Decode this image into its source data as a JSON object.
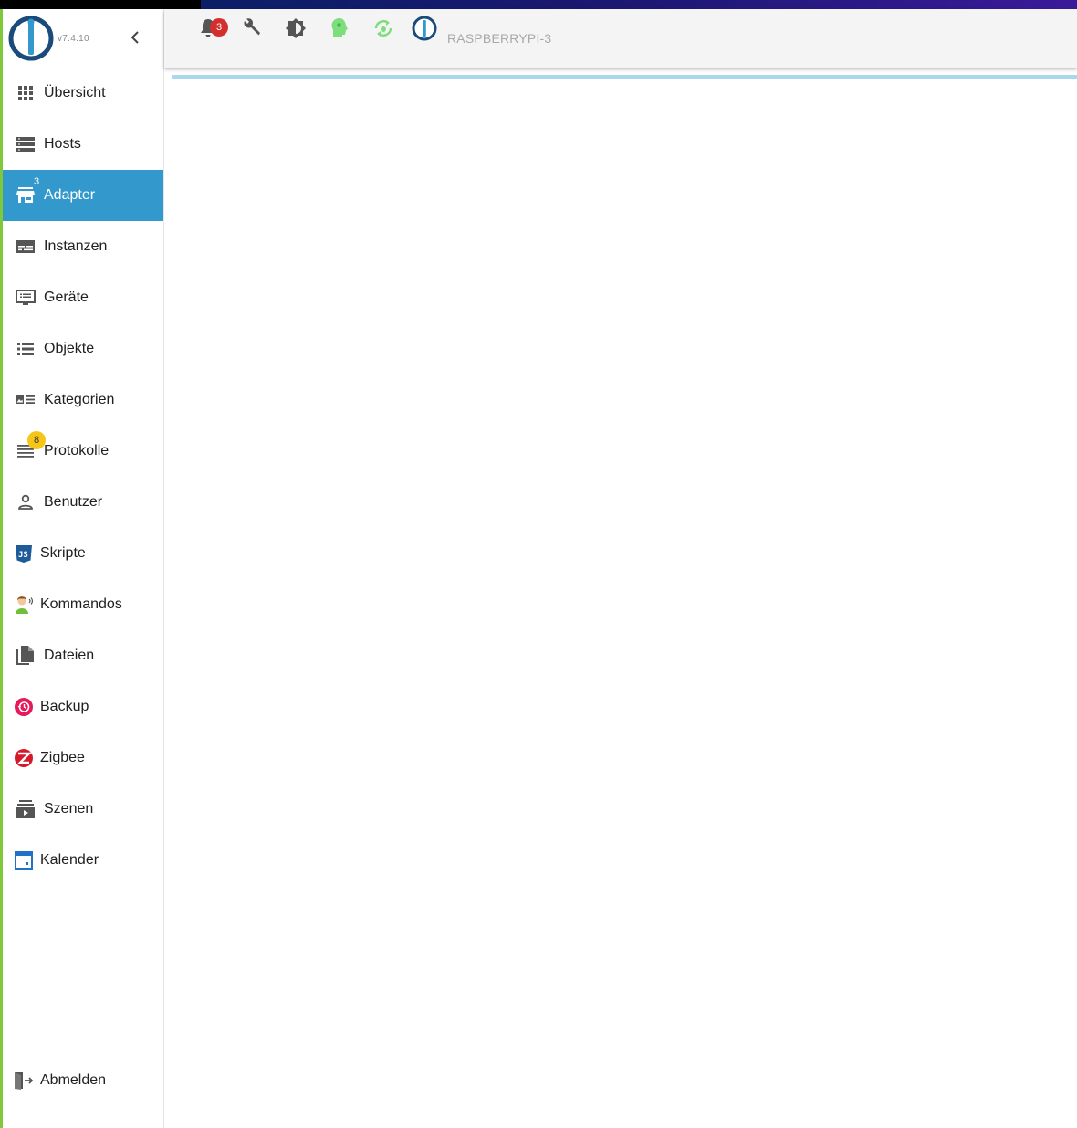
{
  "app": {
    "version": "v7.4.10",
    "hostname": "RASPBERRYPI-3",
    "notifications_count": "3",
    "accent_color": "#3399cc",
    "sidebar_border_color": "#7ec83a"
  },
  "toolbar": {
    "icons": [
      "bell-icon",
      "wrench-icon",
      "brightness-icon",
      "expert-mode-icon",
      "refresh-icon",
      "iobroker-logo-icon"
    ]
  },
  "sidebar": {
    "items": [
      {
        "label": "Übersicht",
        "icon": "grid-icon"
      },
      {
        "label": "Hosts",
        "icon": "server-icon"
      },
      {
        "label": "Adapter",
        "icon": "store-icon",
        "badge": "3",
        "active": true
      },
      {
        "label": "Instanzen",
        "icon": "instances-icon"
      },
      {
        "label": "Geräte",
        "icon": "devices-icon"
      },
      {
        "label": "Objekte",
        "icon": "list-icon"
      },
      {
        "label": "Kategorien",
        "icon": "categories-icon"
      },
      {
        "label": "Protokolle",
        "icon": "log-icon",
        "badge": "8"
      },
      {
        "label": "Benutzer",
        "icon": "user-icon"
      },
      {
        "label": "Skripte",
        "icon": "javascript-icon"
      },
      {
        "label": "Kommandos",
        "icon": "voice-command-icon"
      },
      {
        "label": "Dateien",
        "icon": "files-icon"
      },
      {
        "label": "Backup",
        "icon": "backup-icon"
      },
      {
        "label": "Zigbee",
        "icon": "zigbee-icon"
      },
      {
        "label": "Szenen",
        "icon": "scenes-icon"
      },
      {
        "label": "Kalender",
        "icon": "calendar-icon"
      }
    ],
    "logout_label": "Abmelden"
  }
}
